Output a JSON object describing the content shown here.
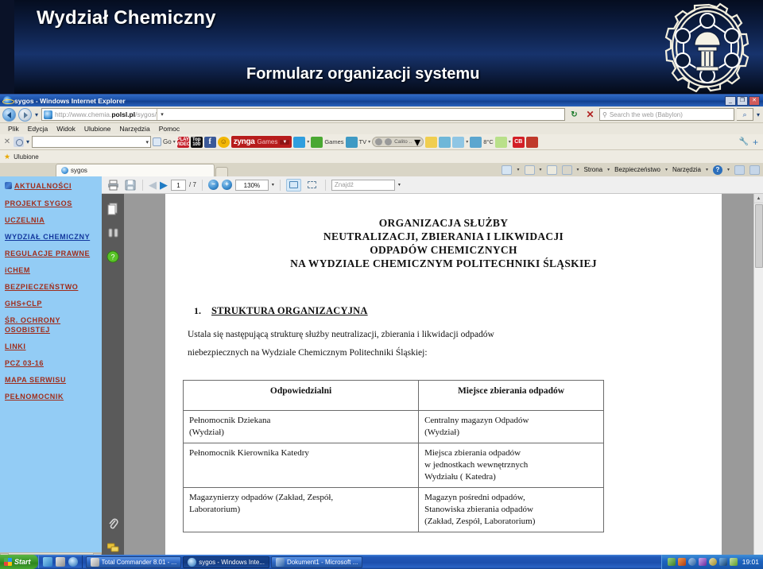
{
  "banner": {
    "title": "Wydział Chemiczny",
    "subtitle": "Formularz organizacji systemu",
    "logo_icon": "silesian-university-gear-logo"
  },
  "browser": {
    "window_title": "sygos - Windows Internet Explorer",
    "title_icon": "internet-explorer-icon",
    "window_buttons": {
      "minimize": "_",
      "restore": "❐",
      "close": "✕"
    },
    "address": {
      "url_prefix": "http://www.chemia.",
      "url_domain": "polsl.pl",
      "url_path": "/sygos/",
      "page_icon": "page-icon",
      "back_icon": "back-arrow-icon",
      "forward_icon": "forward-arrow-icon",
      "history_caret": "▾",
      "dropdown_caret": "▾",
      "refresh_icon": "↻",
      "stop_icon": "✕"
    },
    "search": {
      "placeholder": "Search the web (Babylon)",
      "magnifier_icon": "search-icon",
      "go_icon": "⌕",
      "go_caret": "▾"
    },
    "menu": [
      "Plik",
      "Edycja",
      "Widok",
      "Ulubione",
      "Narzędzia",
      "Pomoc"
    ],
    "addon_toolbar": {
      "close_icon": "✕",
      "logo_icon": "babylon-logo-icon",
      "input_value": "",
      "input_caret": "▾",
      "go_label": "Go",
      "go_caret": "▾",
      "buttons": [
        {
          "name": "play-video-button",
          "label": "PLAY\nVIDEO",
          "class": "play"
        },
        {
          "name": "top100-button",
          "label": "Top\n100",
          "class": "top"
        },
        {
          "name": "facebook-button",
          "label": "f",
          "class": "fb"
        },
        {
          "name": "smiley-button",
          "label": "☺",
          "class": "smile"
        }
      ],
      "zynga": {
        "brand": "zynga",
        "label": "Games",
        "caret": "▼"
      },
      "games_label": "Games",
      "tv_label": "TV",
      "media_label": "Calito ..",
      "weather_temp": "8°C",
      "cb_label": "CB",
      "wrench_icon": "wrench-icon",
      "plus_icon": "+"
    },
    "favorites": {
      "star_icon": "star-icon",
      "label": "Ulubione"
    },
    "tab": {
      "label": "sygos",
      "icon": "internet-explorer-icon"
    },
    "command_bar": {
      "home_icon": "home-icon",
      "feeds_icon": "rss-feed-icon",
      "mail_icon": "mail-icon",
      "print_icon": "printer-icon",
      "caret": "▾",
      "items": [
        "Strona",
        "Bezpieczeństwo",
        "Narzędzia"
      ],
      "help_icon": "?",
      "extra1_icon": "msn-icon",
      "extra2_icon": "blue-square-icon"
    }
  },
  "sidebar": {
    "items": [
      {
        "label": "AKTUALNOŚCI",
        "name": "sidebar-item-aktualnosci",
        "active": false,
        "bullet": true
      },
      {
        "label": "PROJEKT SYGOS",
        "name": "sidebar-item-projekt-sygos",
        "active": false
      },
      {
        "label": "UCZELNIA",
        "name": "sidebar-item-uczelnia",
        "active": false
      },
      {
        "label": "WYDZIAŁ CHEMICZNY",
        "name": "sidebar-item-wydzial-chemiczny",
        "active": true
      },
      {
        "label": "REGULACJE PRAWNE",
        "name": "sidebar-item-regulacje-prawne",
        "active": false
      },
      {
        "label": "iCHEM",
        "name": "sidebar-item-ichem",
        "active": false
      },
      {
        "label": "BEZPIECZEŃSTWO",
        "name": "sidebar-item-bezpieczenstwo",
        "active": false
      },
      {
        "label": "GHS+CLP",
        "name": "sidebar-item-ghs-clp",
        "active": false
      },
      {
        "label": "ŚR. OCHRONY OSOBISTEJ",
        "name": "sidebar-item-sr-ochrony-osobistej",
        "active": false
      },
      {
        "label": "LINKI",
        "name": "sidebar-item-linki",
        "active": false
      },
      {
        "label": "PCZ 03-16",
        "name": "sidebar-item-pcz-03-16",
        "active": false
      },
      {
        "label": "MAPA SERWISU",
        "name": "sidebar-item-mapa-serwisu",
        "active": false
      },
      {
        "label": "PEŁNOMOCNIK",
        "name": "sidebar-item-pelnomocnik",
        "active": false
      }
    ],
    "scroll_left": "◄",
    "scroll_right": "►"
  },
  "pdf": {
    "toolbar": {
      "print_icon": "printer-icon",
      "save_icon": "save-icon",
      "prev_icon": "◀",
      "next_icon": "▶",
      "page_current": "1",
      "page_total": "/ 7",
      "zoom_out": "−",
      "zoom_in": "+",
      "zoom_level": "130%",
      "zoom_caret": "▾",
      "fit_width_icon": "fit-width-icon",
      "fit_page_icon": "fit-page-icon",
      "find_placeholder": "Znajdź",
      "find_caret": "▾"
    },
    "nav_icons": [
      {
        "name": "pages-panel-icon",
        "glyph": "❐"
      },
      {
        "name": "bookmarks-panel-icon",
        "glyph": "‖"
      },
      {
        "name": "help-panel-icon",
        "glyph": "?"
      },
      {
        "name": "attachments-panel-icon",
        "glyph": "ὌE"
      },
      {
        "name": "comments-panel-icon",
        "glyph": "❐"
      }
    ],
    "scroll_up": "▲",
    "scroll_down": "▼"
  },
  "document": {
    "title_lines": [
      "ORGANIZACJA SŁUŻBY",
      "NEUTRALIZACJI, ZBIERANIA I LIKWIDACJI",
      "ODPADÓW CHEMICZNYCH",
      "NA WYDZIALE CHEMICZNYM POLITECHNIKI ŚLĄSKIEJ"
    ],
    "section_number": "1.",
    "section_title": "STRUKTURA ORGANIZACYJNA",
    "paragraph_line1": "Ustala się następującą strukturę służby neutralizacji, zbierania i likwidacji odpadów",
    "paragraph_line2": "niebezpiecznych na Wydziale Chemicznym Politechniki Śląskiej:",
    "table": {
      "headers": [
        "Odpowiedzialni",
        "Miejsce zbierania odpadów"
      ],
      "rows": [
        [
          "Pełnomocnik Dziekana\n(Wydział)",
          "Centralny magazyn Odpadów\n(Wydział)"
        ],
        [
          "Pełnomocnik Kierownika Katedry",
          "Miejsca zbierania odpadów\nw jednostkach wewnętrznych\nWydziału ( Katedra)"
        ],
        [
          "Magazynierzy odpadów (Zakład, Zespół,\nLaboratorium)",
          "Magazyn pośredni odpadów,\nStanowiska zbierania odpadów\n(Zakład, Zespół, Laboratorium)"
        ]
      ]
    }
  },
  "taskbar": {
    "start_label": "Start",
    "start_icon": "windows-flag-icon",
    "quick_launch": [
      "show-desktop-icon",
      "save-icon",
      "internet-explorer-icon"
    ],
    "tasks": [
      {
        "label": "Total Commander 8.01 - ...",
        "icon": "total-commander-icon",
        "active": false
      },
      {
        "label": "sygos - Windows Inte...",
        "icon": "internet-explorer-icon",
        "active": true
      },
      {
        "label": "Dokument1 - Microsoft ...",
        "icon": "word-icon",
        "active": false
      }
    ],
    "tray_icons": [
      "network-icon",
      "antivirus-icon",
      "bluetooth-icon",
      "volume-icon",
      "update-icon",
      "display-icon",
      "usb-icon"
    ],
    "clock": "19:01"
  }
}
